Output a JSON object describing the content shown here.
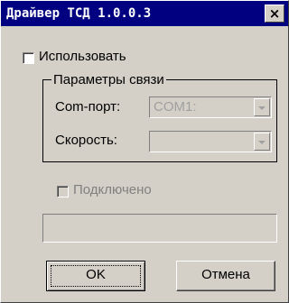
{
  "window": {
    "title": "Драйвер ТСД 1.0.0.3",
    "close_symbol": "×"
  },
  "use_checkbox": {
    "label": "Использовать",
    "checked": false
  },
  "connection_group": {
    "title": "Параметры связи",
    "com_port": {
      "label": "Com-порт:",
      "value": "COM1:",
      "enabled": false
    },
    "speed": {
      "label": "Скорость:",
      "value": "",
      "enabled": false
    }
  },
  "connected_checkbox": {
    "label": "Подключено",
    "checked": false,
    "enabled": false
  },
  "status_field": {
    "value": ""
  },
  "buttons": {
    "ok": "OK",
    "cancel": "Отмена"
  }
}
